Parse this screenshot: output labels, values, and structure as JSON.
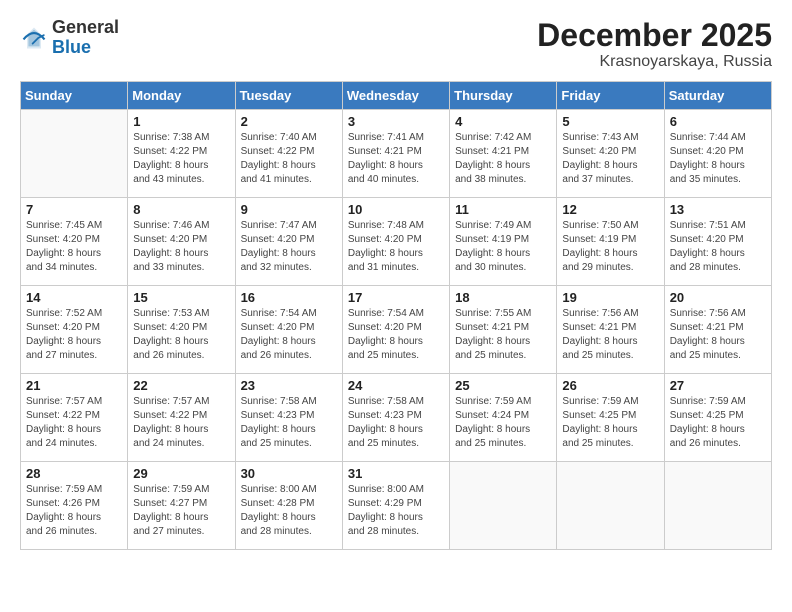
{
  "logo": {
    "general": "General",
    "blue": "Blue"
  },
  "title": "December 2025",
  "subtitle": "Krasnoyarskaya, Russia",
  "days_of_week": [
    "Sunday",
    "Monday",
    "Tuesday",
    "Wednesday",
    "Thursday",
    "Friday",
    "Saturday"
  ],
  "weeks": [
    [
      {
        "day": "",
        "info": ""
      },
      {
        "day": "1",
        "info": "Sunrise: 7:38 AM\nSunset: 4:22 PM\nDaylight: 8 hours\nand 43 minutes."
      },
      {
        "day": "2",
        "info": "Sunrise: 7:40 AM\nSunset: 4:22 PM\nDaylight: 8 hours\nand 41 minutes."
      },
      {
        "day": "3",
        "info": "Sunrise: 7:41 AM\nSunset: 4:21 PM\nDaylight: 8 hours\nand 40 minutes."
      },
      {
        "day": "4",
        "info": "Sunrise: 7:42 AM\nSunset: 4:21 PM\nDaylight: 8 hours\nand 38 minutes."
      },
      {
        "day": "5",
        "info": "Sunrise: 7:43 AM\nSunset: 4:20 PM\nDaylight: 8 hours\nand 37 minutes."
      },
      {
        "day": "6",
        "info": "Sunrise: 7:44 AM\nSunset: 4:20 PM\nDaylight: 8 hours\nand 35 minutes."
      }
    ],
    [
      {
        "day": "7",
        "info": "Sunrise: 7:45 AM\nSunset: 4:20 PM\nDaylight: 8 hours\nand 34 minutes."
      },
      {
        "day": "8",
        "info": "Sunrise: 7:46 AM\nSunset: 4:20 PM\nDaylight: 8 hours\nand 33 minutes."
      },
      {
        "day": "9",
        "info": "Sunrise: 7:47 AM\nSunset: 4:20 PM\nDaylight: 8 hours\nand 32 minutes."
      },
      {
        "day": "10",
        "info": "Sunrise: 7:48 AM\nSunset: 4:20 PM\nDaylight: 8 hours\nand 31 minutes."
      },
      {
        "day": "11",
        "info": "Sunrise: 7:49 AM\nSunset: 4:19 PM\nDaylight: 8 hours\nand 30 minutes."
      },
      {
        "day": "12",
        "info": "Sunrise: 7:50 AM\nSunset: 4:19 PM\nDaylight: 8 hours\nand 29 minutes."
      },
      {
        "day": "13",
        "info": "Sunrise: 7:51 AM\nSunset: 4:20 PM\nDaylight: 8 hours\nand 28 minutes."
      }
    ],
    [
      {
        "day": "14",
        "info": "Sunrise: 7:52 AM\nSunset: 4:20 PM\nDaylight: 8 hours\nand 27 minutes."
      },
      {
        "day": "15",
        "info": "Sunrise: 7:53 AM\nSunset: 4:20 PM\nDaylight: 8 hours\nand 26 minutes."
      },
      {
        "day": "16",
        "info": "Sunrise: 7:54 AM\nSunset: 4:20 PM\nDaylight: 8 hours\nand 26 minutes."
      },
      {
        "day": "17",
        "info": "Sunrise: 7:54 AM\nSunset: 4:20 PM\nDaylight: 8 hours\nand 25 minutes."
      },
      {
        "day": "18",
        "info": "Sunrise: 7:55 AM\nSunset: 4:21 PM\nDaylight: 8 hours\nand 25 minutes."
      },
      {
        "day": "19",
        "info": "Sunrise: 7:56 AM\nSunset: 4:21 PM\nDaylight: 8 hours\nand 25 minutes."
      },
      {
        "day": "20",
        "info": "Sunrise: 7:56 AM\nSunset: 4:21 PM\nDaylight: 8 hours\nand 25 minutes."
      }
    ],
    [
      {
        "day": "21",
        "info": "Sunrise: 7:57 AM\nSunset: 4:22 PM\nDaylight: 8 hours\nand 24 minutes."
      },
      {
        "day": "22",
        "info": "Sunrise: 7:57 AM\nSunset: 4:22 PM\nDaylight: 8 hours\nand 24 minutes."
      },
      {
        "day": "23",
        "info": "Sunrise: 7:58 AM\nSunset: 4:23 PM\nDaylight: 8 hours\nand 25 minutes."
      },
      {
        "day": "24",
        "info": "Sunrise: 7:58 AM\nSunset: 4:23 PM\nDaylight: 8 hours\nand 25 minutes."
      },
      {
        "day": "25",
        "info": "Sunrise: 7:59 AM\nSunset: 4:24 PM\nDaylight: 8 hours\nand 25 minutes."
      },
      {
        "day": "26",
        "info": "Sunrise: 7:59 AM\nSunset: 4:25 PM\nDaylight: 8 hours\nand 25 minutes."
      },
      {
        "day": "27",
        "info": "Sunrise: 7:59 AM\nSunset: 4:25 PM\nDaylight: 8 hours\nand 26 minutes."
      }
    ],
    [
      {
        "day": "28",
        "info": "Sunrise: 7:59 AM\nSunset: 4:26 PM\nDaylight: 8 hours\nand 26 minutes."
      },
      {
        "day": "29",
        "info": "Sunrise: 7:59 AM\nSunset: 4:27 PM\nDaylight: 8 hours\nand 27 minutes."
      },
      {
        "day": "30",
        "info": "Sunrise: 8:00 AM\nSunset: 4:28 PM\nDaylight: 8 hours\nand 28 minutes."
      },
      {
        "day": "31",
        "info": "Sunrise: 8:00 AM\nSunset: 4:29 PM\nDaylight: 8 hours\nand 28 minutes."
      },
      {
        "day": "",
        "info": ""
      },
      {
        "day": "",
        "info": ""
      },
      {
        "day": "",
        "info": ""
      }
    ]
  ]
}
